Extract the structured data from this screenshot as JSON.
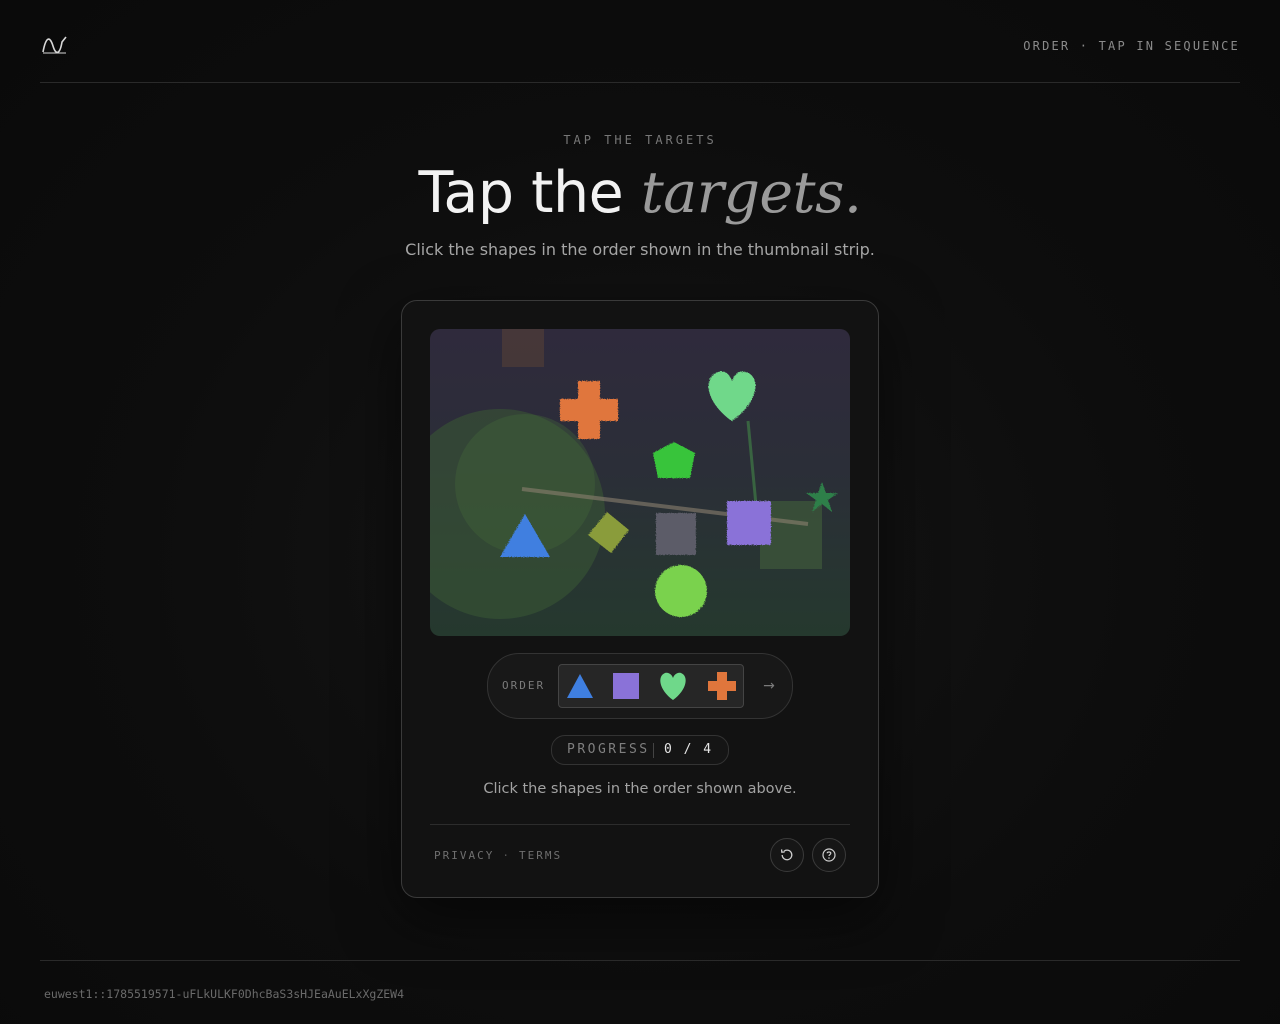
{
  "header": {
    "logo": "wave-logo-icon",
    "meta": "ORDER · TAP IN SEQUENCE"
  },
  "hero": {
    "eyebrow": "TAP THE TARGETS",
    "title_plain": "Tap the",
    "title_accent": "targets.",
    "subtitle": "Click the shapes in the order shown in the thumbnail strip."
  },
  "challenge": {
    "shapes": [
      {
        "name": "orange-cross",
        "color": "#e0763c"
      },
      {
        "name": "green-heart",
        "color": "#6fd88a"
      },
      {
        "name": "green-pentagon",
        "color": "#39c43a"
      },
      {
        "name": "blue-triangle",
        "color": "#3f7fe0"
      },
      {
        "name": "olive-diamond",
        "color": "#8a9c3a"
      },
      {
        "name": "gray-square",
        "color": "#5b5b68"
      },
      {
        "name": "purple-square",
        "color": "#8a72d8"
      },
      {
        "name": "green-circle",
        "color": "#7ad24e"
      },
      {
        "name": "dark-green-star",
        "color": "#2f7f4a"
      }
    ],
    "order_label": "ORDER",
    "order": [
      {
        "shape": "triangle-icon",
        "color": "#3f7fe0"
      },
      {
        "shape": "square-icon",
        "color": "#8a72d8"
      },
      {
        "shape": "heart-icon",
        "color": "#6fd88a"
      },
      {
        "shape": "cross-icon",
        "color": "#e0763c"
      }
    ],
    "next_arrow": "→",
    "progress_label": "PROGRESS",
    "progress_value": "0 / 4",
    "progress_done": 0,
    "progress_total": 4,
    "instruction": "Click the shapes in the order shown above."
  },
  "card_footer": {
    "privacy": "PRIVACY",
    "separator": "·",
    "terms": "TERMS",
    "refresh_icon": "refresh-icon",
    "help_icon": "help-icon"
  },
  "footer": {
    "token": "euwest1::1785519571-uFLkULKF0DhcBaS3sHJEaAuELxXgZEW4"
  }
}
